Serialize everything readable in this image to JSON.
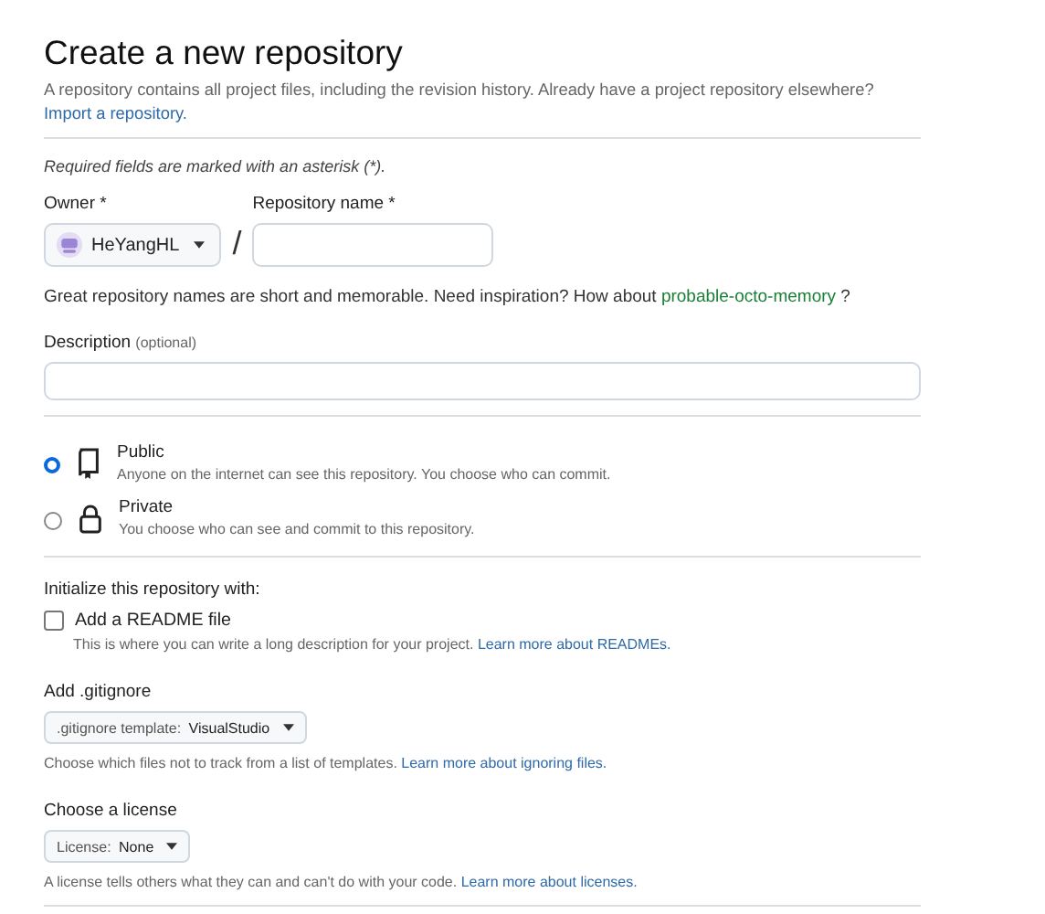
{
  "heading": "Create a new repository",
  "intro": {
    "text": "A repository contains all project files, including the revision history. Already have a project repository elsewhere?",
    "link": "Import a repository."
  },
  "required_note": "Required fields are marked with an asterisk (*).",
  "owner": {
    "label": "Owner *",
    "value": "HeYangHL"
  },
  "separator": "/",
  "repository_name": {
    "label": "Repository name *"
  },
  "name_hint": {
    "text": "Great repository names are short and memorable. Need inspiration? How about",
    "suggestion": "probable-octo-memory",
    "after": "?"
  },
  "description": {
    "label": "Description",
    "optional": "(optional)"
  },
  "visibility": [
    {
      "kind": "repo",
      "label": "Public",
      "description": "Anyone on the internet can see this repository. You choose who can commit.",
      "selected": true
    },
    {
      "kind": "lock",
      "label": "Private",
      "description": "You choose who can see and commit to this repository.",
      "selected": false
    }
  ],
  "initialize": {
    "heading": "Initialize this repository with:",
    "readme": {
      "label": "Add a README file",
      "checked": false,
      "help": "This is where you can write a long description for your project.",
      "link": "Learn more about READMEs."
    }
  },
  "gitignore": {
    "label": "Add .gitignore",
    "prefix": ".gitignore template:",
    "value": "VisualStudio",
    "help": "Choose which files not to track from a list of templates.",
    "link": "Learn more about ignoring files."
  },
  "license": {
    "label": "Choose a license",
    "prefix": "License:",
    "value": "None",
    "help": "A license tells others what they can and can't do with your code.",
    "link": "Learn more about licenses."
  }
}
